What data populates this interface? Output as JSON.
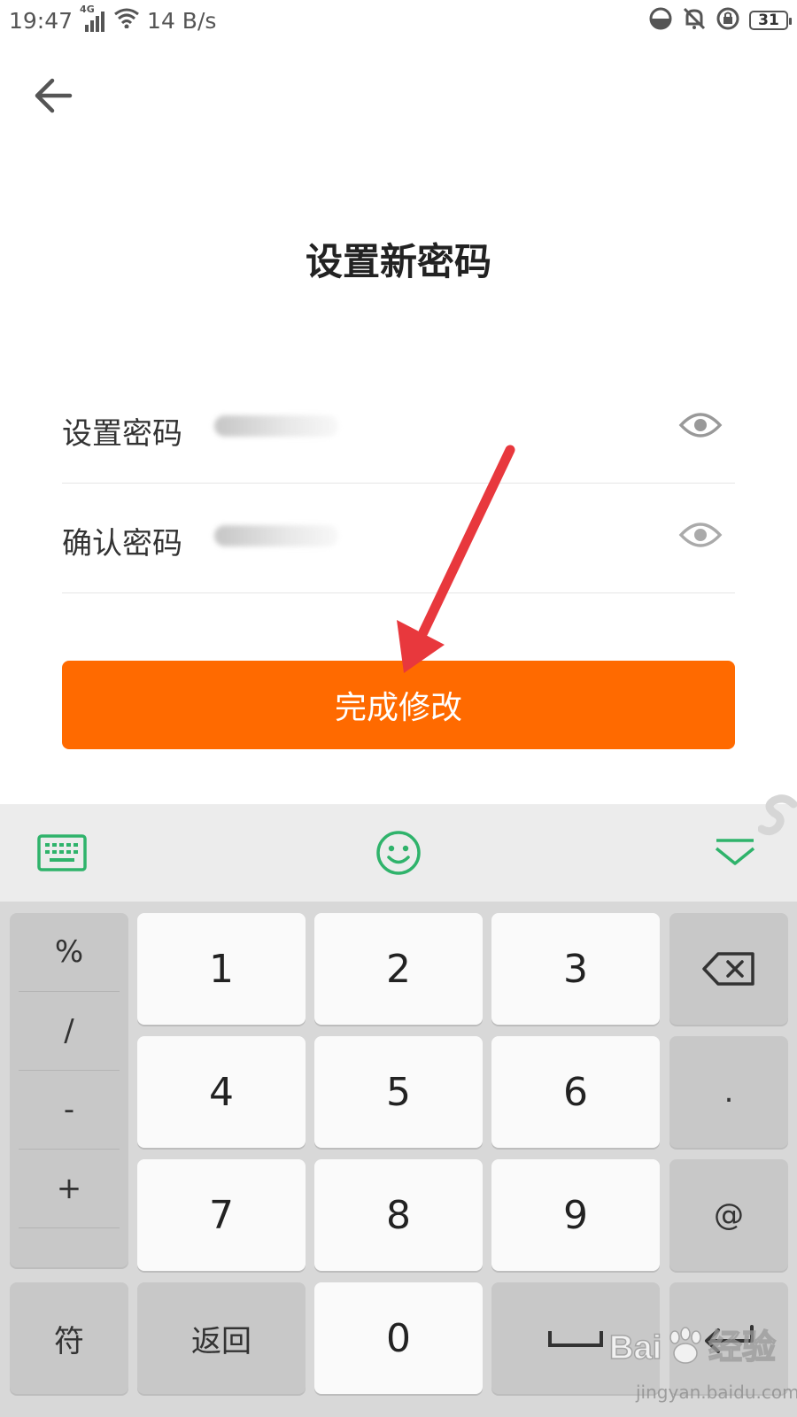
{
  "status_bar": {
    "time": "19:47",
    "network_type": "4G",
    "speed": "14 B/s",
    "battery": "31"
  },
  "nav": {
    "back_icon": "arrow-left-icon"
  },
  "title": "设置新密码",
  "form": {
    "password": {
      "label": "设置密码",
      "value": "••••••••",
      "toggle_icon": "eye-icon"
    },
    "confirm": {
      "label": "确认密码",
      "value": "••••••••",
      "toggle_icon": "eye-icon"
    },
    "submit_label": "完成修改"
  },
  "keyboard": {
    "toolbar": {
      "left_icon": "keyboard-icon",
      "center_icon": "smiley-icon",
      "right_icon": "collapse-chevron-icon"
    },
    "symbols": [
      "%",
      "/",
      "-",
      "+"
    ],
    "digits": [
      "1",
      "2",
      "3",
      "4",
      "5",
      "6",
      "7",
      "8",
      "9",
      "0"
    ],
    "right_keys": {
      "backspace_icon": "backspace-icon",
      "dot": ".",
      "at": "@",
      "enter_icon": "enter-icon"
    },
    "bottom": {
      "symbols_label": "符",
      "back_label": "返回",
      "space_icon": "space-icon"
    }
  },
  "watermark": {
    "brand": "Baidu经验",
    "site": "jingyan.baidu.com"
  },
  "colors": {
    "accent": "#ff6a00",
    "keyboard_green": "#2fb36b"
  }
}
